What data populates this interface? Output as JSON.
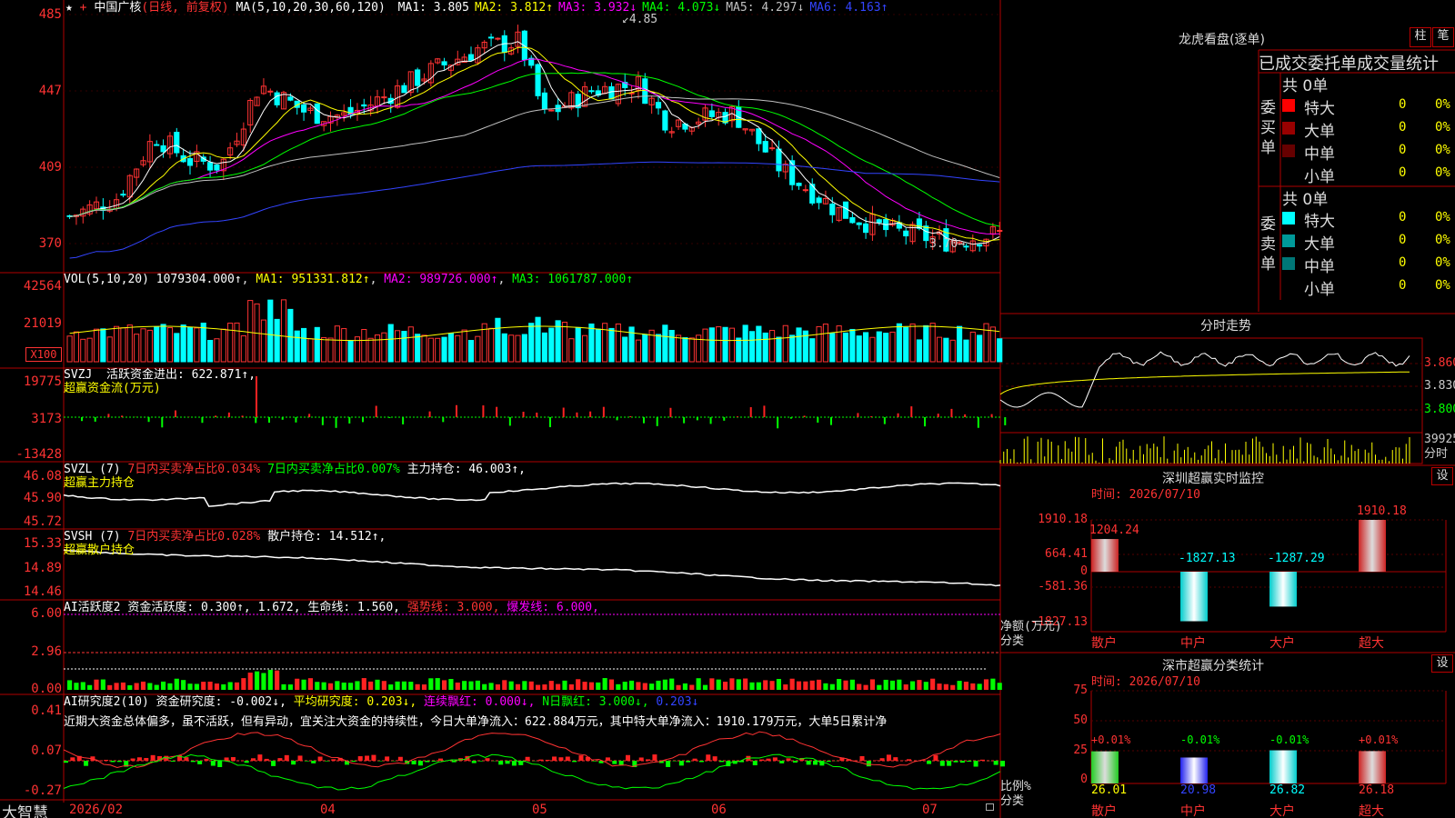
{
  "main": {
    "stock_name": "中国广核",
    "mode": "(日线, 前复权)",
    "ma_label": "MA(5,10,20,30,60,120)",
    "ma_values": [
      {
        "label": "MA1: 3.805",
        "color": "#ffffff"
      },
      {
        "label": "MA2: 3.812↑",
        "color": "#ffff00"
      },
      {
        "label": "MA3: 3.932↓",
        "color": "#ff00ff"
      },
      {
        "label": "MA4: 4.073↓",
        "color": "#00ff00"
      },
      {
        "label": "MA5: 4.297↓",
        "color": "#c0c0c0"
      },
      {
        "label": "MA6: 4.163↑",
        "color": "#3344ff"
      }
    ],
    "y_ticks": [
      "485",
      "447",
      "409",
      "370"
    ],
    "high_label": "4.85",
    "low_label": "3.70"
  },
  "vol": {
    "label": "VOL(5,10,20)",
    "value": "1079304.000↑",
    "ma1": "MA1: 951331.812↑",
    "ma2": "MA2: 989726.000↑",
    "ma3": "MA3: 1061787.000↑",
    "y_ticks": [
      "42564",
      "21019"
    ],
    "unit": "X100"
  },
  "svzj": {
    "label": "SVZJ",
    "value": "活跃资金进出: 622.871↑",
    "subtitle": "超赢资金流(万元)",
    "y_ticks": [
      "19775",
      "3173",
      "-13428"
    ]
  },
  "svzl": {
    "label": "SVZL (7)",
    "item1": "7日内买卖净占比0.034%",
    "item2": "7日内买卖净占比0.007%",
    "item3": "主力持仓: 46.003↑,",
    "subtitle": "超赢主力持仓",
    "y_ticks": [
      "46.08",
      "45.90",
      "45.72"
    ]
  },
  "svsh": {
    "label": "SVSH (7)",
    "item1": "7日内买卖净占比0.028%",
    "item2": "散户持仓: 14.512↑,",
    "subtitle": "超赢散户持仓",
    "y_ticks": [
      "15.33",
      "14.89",
      "14.46"
    ]
  },
  "ai1": {
    "label": "AI活跃度2",
    "item1": "资金活跃度: 0.300↑, 1.672, 生命线: 1.560,",
    "item2": "强势线: 3.000,",
    "item3": "爆发线: 6.000,",
    "y_ticks": [
      "6.00",
      "2.96",
      "0.00"
    ]
  },
  "ai2": {
    "label": "AI研究度2(10)",
    "item1": "资金研究度: -0.002↓,",
    "item2": "平均研究度: 0.203↓,",
    "item3": "连续飘红: 0.000↓,",
    "item4": "N日飘红: 3.000↓,",
    "item5": "0.203↓",
    "commentary": "近期大资金总体偏多，虽不活跃，但有异动，宜关注大资金的持续性，今日大单净流入：622.884万元，其中特大单净流入：1910.179万元，大单5日累计净",
    "y_ticks": [
      "0.41",
      "0.07",
      "-0.27"
    ]
  },
  "bottom": {
    "logo": "大智慧",
    "dates": [
      "2026/02",
      "04",
      "05",
      "06",
      "07"
    ]
  },
  "right": {
    "lhb_title": "龙虎看盘(逐单)",
    "btn_zhu": "柱",
    "btn_bi": "笔",
    "tabs_label": "已成交委托单成交量统计",
    "buy_group": "委买单",
    "sell_group": "委卖单",
    "buy_total": "共 0单",
    "sell_total": "共 0单",
    "buy_rows": [
      {
        "name": "特大",
        "count": "0",
        "pct": "0%",
        "color": "#ff0000"
      },
      {
        "name": "大单",
        "count": "0",
        "pct": "0%",
        "color": "#990000"
      },
      {
        "name": "中单",
        "count": "0",
        "pct": "0%",
        "color": "#660000"
      },
      {
        "name": "小单",
        "count": "0",
        "pct": "0%",
        "color": ""
      }
    ],
    "sell_rows": [
      {
        "name": "特大",
        "count": "0",
        "pct": "0%",
        "color": "#00ffff"
      },
      {
        "name": "大单",
        "count": "0",
        "pct": "0%",
        "color": "#009999"
      },
      {
        "name": "中单",
        "count": "0",
        "pct": "0%",
        "color": "#007777"
      },
      {
        "name": "小单",
        "count": "0",
        "pct": "0%",
        "color": ""
      }
    ],
    "fenshi_title": "分时走势",
    "fenshi_y": [
      "3.860",
      "3.830",
      "3.800"
    ],
    "fenshi_vol": "39925",
    "fenshi_vol_label": "分时",
    "sz_title": "深圳超赢实时监控",
    "sz_set": "设",
    "sz_time": "时间: 2026/07/10",
    "sz_y": [
      "1910.18",
      "664.41",
      "0",
      "-581.36",
      "-1827.13"
    ],
    "sz_unit": "净额(万元)",
    "sz_cat_label": "分类",
    "sz_bars": [
      {
        "cat": "散户",
        "value": "1204.24"
      },
      {
        "cat": "中户",
        "value": "-1827.13"
      },
      {
        "cat": "大户",
        "value": "-1287.29"
      },
      {
        "cat": "超大",
        "value": "1910.18"
      }
    ],
    "ss_title": "深市超赢分类统计",
    "ss_set": "设",
    "ss_time": "时间: 2026/07/10",
    "ss_y": [
      "75",
      "50",
      "25",
      "0"
    ],
    "ss_unit": "比例%",
    "ss_cat_label": "分类",
    "ss_bars": [
      {
        "cat": "散户",
        "value": "26.01",
        "delta": "+0.01%"
      },
      {
        "cat": "中户",
        "value": "20.98",
        "delta": "-0.01%"
      },
      {
        "cat": "大户",
        "value": "26.82",
        "delta": "-0.01%"
      },
      {
        "cat": "超大",
        "value": "26.18",
        "delta": "+0.01%"
      }
    ]
  }
}
